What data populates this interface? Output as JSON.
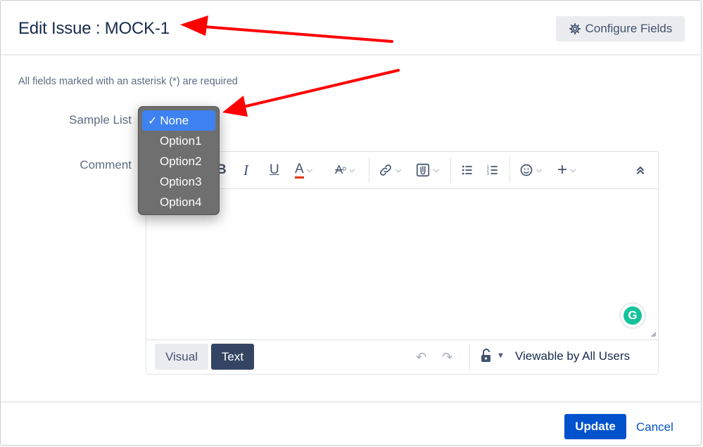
{
  "header": {
    "title": "Edit Issue : MOCK-1",
    "configure_label": "Configure Fields"
  },
  "form": {
    "required_note": "All fields marked with an asterisk (*) are required",
    "sample_list_label": "Sample List",
    "comment_label": "Comment"
  },
  "dropdown": {
    "selected": "None",
    "options": [
      "None",
      "Option1",
      "Option2",
      "Option3",
      "Option4"
    ]
  },
  "toolbar": {
    "icons": [
      "bold-icon",
      "italic-icon",
      "underline-icon",
      "text-color-icon",
      "text-format-icon",
      "link-icon",
      "attachment-icon",
      "bullet-list-icon",
      "numbered-list-icon",
      "emoji-icon",
      "insert-more-icon",
      "collapse-toolbar-icon"
    ]
  },
  "editor": {
    "mode_visual": "Visual",
    "mode_text": "Text",
    "visibility": "Viewable by All Users"
  },
  "footer": {
    "update_label": "Update",
    "cancel_label": "Cancel"
  },
  "colors": {
    "primary": "#0052cc",
    "text_mode_bg": "#344563",
    "annotation": "#ff0000",
    "selection": "#3d82f0"
  }
}
